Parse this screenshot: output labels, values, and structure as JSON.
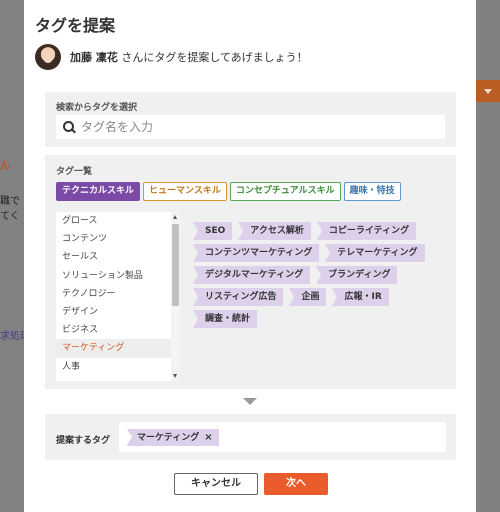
{
  "background": {
    "fragments": [
      "ん",
      "職で",
      "てく",
      "求処理"
    ],
    "accent": "#b95d22"
  },
  "modal": {
    "title": "タグを提案",
    "user_name": "加藤 凜花",
    "user_suffix": " さん",
    "user_message": "にタグを提案してあげましょう！"
  },
  "search": {
    "label": "検索からタグを選択",
    "placeholder": "タグ名を入力",
    "value": ""
  },
  "tag_list": {
    "label": "タグ一覧",
    "tabs": [
      {
        "label": "テクニカルスキル",
        "active": true
      },
      {
        "label": "ヒューマンスキル",
        "active": false
      },
      {
        "label": "コンセプチュアルスキル",
        "active": false
      },
      {
        "label": "趣味・特技",
        "active": false
      }
    ],
    "categories": [
      "グロース",
      "コンテンツ",
      "セールス",
      "ソリューション製品",
      "テクノロジー",
      "デザイン",
      "ビジネス",
      "マーケティング",
      "人事"
    ],
    "selected_category": "マーケティング",
    "tags": [
      "SEO",
      "アクセス解析",
      "コピーライティング",
      "コンテンツマーケティング",
      "テレマーケティング",
      "デジタルマーケティング",
      "ブランディング",
      "リスティング広告",
      "企画",
      "広報・IR",
      "調査・統計"
    ]
  },
  "propose": {
    "label": "提案するタグ",
    "selected": [
      "マーケティング"
    ],
    "remove_symbol": "×"
  },
  "buttons": {
    "cancel": "キャンセル",
    "next": "次へ"
  },
  "colors": {
    "primary_purple": "#7b4aa6",
    "tag_chip": "#ddd0ea",
    "next_button": "#ea5b2c",
    "selected_category_text": "#d2551e"
  }
}
